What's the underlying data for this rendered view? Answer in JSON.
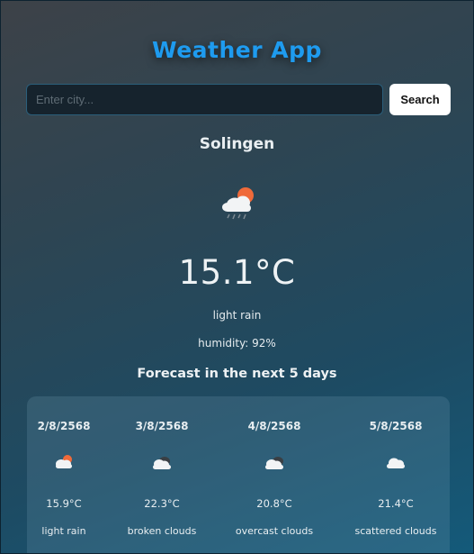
{
  "app": {
    "title": "Weather App"
  },
  "search": {
    "placeholder": "Enter city...",
    "value": "",
    "button_label": "Search"
  },
  "current": {
    "city": "Solingen",
    "icon": "rain-cloud-sun-icon",
    "temperature": "15.1°C",
    "description": "light rain",
    "humidity": "humidity: 92%"
  },
  "forecast": {
    "title": "Forecast in the next 5 days",
    "days": [
      {
        "date": "2/8/2568",
        "icon": "cloud-sun-icon",
        "temperature": "15.9°C",
        "description": "light rain"
      },
      {
        "date": "3/8/2568",
        "icon": "broken-clouds-icon",
        "temperature": "22.3°C",
        "description": "broken clouds"
      },
      {
        "date": "4/8/2568",
        "icon": "overcast-clouds-icon",
        "temperature": "20.8°C",
        "description": "overcast clouds"
      },
      {
        "date": "5/8/2568",
        "icon": "scattered-clouds-icon",
        "temperature": "21.4°C",
        "description": "scattered clouds"
      }
    ]
  },
  "colors": {
    "title": "#1e9bef",
    "button_bg": "#ffffff",
    "input_bg": "#16232d",
    "sun": "#ef6a3a"
  }
}
